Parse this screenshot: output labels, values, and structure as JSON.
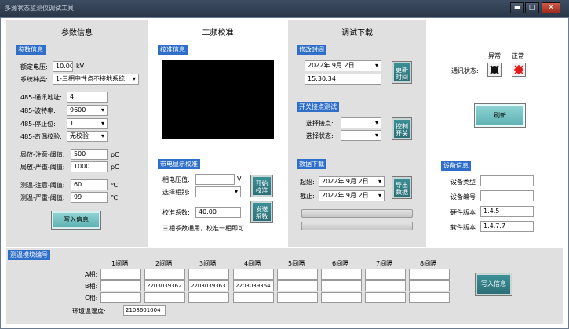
{
  "window": {
    "title": "多源状态监测仪调试工具",
    "btn_min": "▬",
    "btn_max": "□",
    "btn_close": "✕"
  },
  "params": {
    "title": "参数信息",
    "section": "参数信息",
    "rated_voltage_label": "额定电压:",
    "rated_voltage": "10.00",
    "rated_voltage_unit": "kV",
    "system_type_label": "系统种类:",
    "system_type": "1-三相中性点不接地系统",
    "addr_label": "485-通讯地址:",
    "addr": "4",
    "baud_label": "485-波特率:",
    "baud": "9600",
    "stop_label": "485-停止位:",
    "stop": "1",
    "parity_label": "485-奇偶校验:",
    "parity": "无校验",
    "pd_warn_label": "局放-注意-阈值:",
    "pd_warn": "500",
    "pd_warn_unit": "pC",
    "pd_sev_label": "局放-严重-阈值:",
    "pd_sev": "1000",
    "pd_sev_unit": "pC",
    "t_warn_label": "测温-注意-阈值:",
    "t_warn": "60",
    "t_warn_unit": "℃",
    "t_sev_label": "测温-严重-阈值:",
    "t_sev": "99",
    "t_sev_unit": "℃",
    "write_btn": "写入信息"
  },
  "calib": {
    "title": "工频校准",
    "section": "校准信息",
    "live_section": "带电显示校准",
    "voltage_label": "相电压值:",
    "voltage": "",
    "voltage_unit": "V",
    "phase_label": "选择相别:",
    "phase": "",
    "coef_label": "校准系数:",
    "coef": "40.00",
    "note": "三相系数通用，校准一相即可",
    "start_btn": "开始校准",
    "send_btn": "发送系数"
  },
  "debug": {
    "title": "调试下载",
    "time_section": "修改时间",
    "date": "2022年 9月 2日",
    "time": "15:30:34",
    "change_time_btn": "更新时间",
    "switch_section": "开关接点测试",
    "contact_label": "选择接点:",
    "contact": "",
    "state_label": "选择状态:",
    "state": "",
    "switch_btn": "控制开关",
    "download_section": "数据下载",
    "start_label": "起始:",
    "start_date": "2022年 9月 2日",
    "end_label": "截止:",
    "end_date": "2022年 9月 2日",
    "export_btn": "导出数据"
  },
  "comm": {
    "abnormal_label": "异常",
    "normal_label": "正常",
    "status_label": "通讯状态:",
    "refresh_btn": "刷新"
  },
  "device": {
    "section": "设备信息",
    "type_label": "设备类型",
    "type": "",
    "id_label": "设备编号",
    "id": "",
    "hw_label": "硬件版本",
    "hw": "1.4.5",
    "sw_label": "软件版本",
    "sw": "1.4.7.7"
  },
  "temp_module": {
    "section": "测温模块编号",
    "intervals": [
      "1间隔",
      "2间隔",
      "3间隔",
      "4间隔",
      "5间隔",
      "6间隔",
      "7间隔",
      "8间隔"
    ],
    "rows": [
      {
        "label": "A相:",
        "values": [
          "",
          "",
          "",
          "",
          "",
          "",
          "",
          ""
        ]
      },
      {
        "label": "B相:",
        "values": [
          "",
          "2203039362",
          "2203039363",
          "2203039364",
          "",
          "",
          "",
          ""
        ]
      },
      {
        "label": "C相:",
        "values": [
          "",
          "",
          "",
          "",
          "",
          "",
          "",
          ""
        ]
      }
    ],
    "env_label": "环境温湿度:",
    "env": "2108601004",
    "write_btn": "写入信息"
  },
  "colors": {
    "tag_blue": "#2f6fc9",
    "btn_teal": "#2d6f76",
    "indicator_red": "#e11b1b"
  }
}
